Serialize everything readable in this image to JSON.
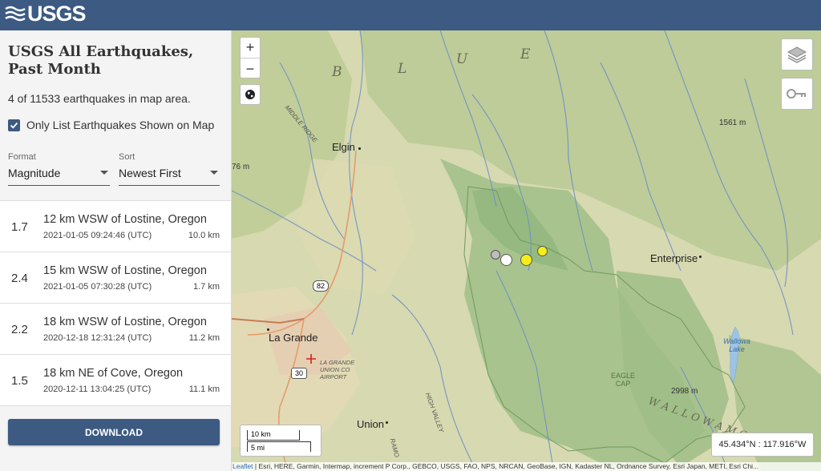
{
  "header": {
    "logo_text": "USGS"
  },
  "sidebar": {
    "title": "USGS All Earthquakes, Past Month",
    "count_text": "4 of 11533 earthquakes in map area.",
    "only_list_label": "Only List Earthquakes Shown on Map",
    "only_list_checked": true,
    "format_label": "Format",
    "format_value": "Magnitude",
    "sort_label": "Sort",
    "sort_value": "Newest First",
    "earthquakes": [
      {
        "mag": "1.7",
        "place": "12 km WSW of Lostine, Oregon",
        "time": "2021-01-05 09:24:46 (UTC)",
        "depth": "10.0 km"
      },
      {
        "mag": "2.4",
        "place": "15 km WSW of Lostine, Oregon",
        "time": "2021-01-05 07:30:28 (UTC)",
        "depth": "1.7 km"
      },
      {
        "mag": "2.2",
        "place": "18 km WSW of Lostine, Oregon",
        "time": "2020-12-18 12:31:24 (UTC)",
        "depth": "11.2 km"
      },
      {
        "mag": "1.5",
        "place": "18 km NE of Cove, Oregon",
        "time": "2020-12-11 13:04:25 (UTC)",
        "depth": "11.1 km"
      }
    ],
    "download_label": "DOWNLOAD"
  },
  "map": {
    "zoom_in": "+",
    "zoom_out": "−",
    "places": {
      "elgin": "Elgin",
      "enterprise": "Enterprise",
      "la_grande": "La Grande",
      "union": "Union",
      "wallowa_lake": "Wallowa Lake",
      "eagle_cap": "EAGLE CAP",
      "airport": "LA GRANDE UNION CO AIRPORT",
      "middle_ridge": "MIDDLE RIDGE",
      "high_valley": "HIGH VALLEY",
      "ramo": "RAMO"
    },
    "ridge_letters": {
      "b": "B",
      "l": "L",
      "u": "U",
      "e": "E",
      "wallowa": "W A L L O W A   M O V"
    },
    "elevations": {
      "e1": "1561 m",
      "e2": "2998 m",
      "e3": "76 m"
    },
    "highways": {
      "h82": "82",
      "h30": "30"
    },
    "scale_km": "10 km",
    "scale_mi": "5 mi",
    "coords": "45.434°N : 117.916°W",
    "attribution_link": "Leaflet",
    "attribution": " | Esri, HERE, Garmin, Intermap, increment P Corp., GEBCO, USGS, FAO, NPS, NRCAN, GeoBase, IGN, Kadaster NL, Ordnance Survey, Esri Japan, METI, Esri Chi..."
  },
  "colors": {
    "header": "#3c5a82",
    "quake_recent": "#f5ee1a",
    "quake_week": "#ffffff",
    "quake_month": "#bdbdbd"
  },
  "icons": {
    "layers": "layers-icon",
    "key": "key-icon",
    "globe": "globe-icon",
    "check": "check-icon"
  }
}
